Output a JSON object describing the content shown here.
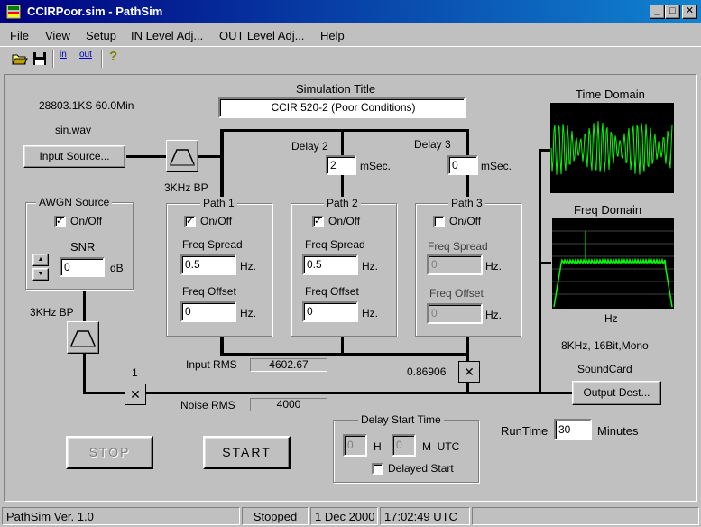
{
  "window": {
    "title": "CCIRPoor.sim - PathSim"
  },
  "menu": [
    "File",
    "View",
    "Setup",
    "IN Level Adj...",
    "OUT Level Adj...",
    "Help"
  ],
  "toolbar": {
    "in_label": "in",
    "out_label": "out",
    "help": "?"
  },
  "input": {
    "info": "28803.1KS  60.0Min",
    "file": "sin.wav",
    "source_button": "Input Source...",
    "bp_label": "3KHz BP"
  },
  "simulation": {
    "title_label": "Simulation Title",
    "title_value": "CCIR 520-2 (Poor Conditions)"
  },
  "delays": {
    "delay2_label": "Delay 2",
    "delay2_value": "2",
    "delay3_label": "Delay 3",
    "delay3_value": "0",
    "unit": "mSec."
  },
  "awgn": {
    "title": "AWGN Source",
    "onoff_label": "On/Off",
    "onoff_checked": true,
    "snr_label": "SNR",
    "snr_value": "0",
    "unit": "dB",
    "bp_label": "3KHz BP"
  },
  "paths": [
    {
      "title": "Path 1",
      "onoff_label": "On/Off",
      "checked": true,
      "spread_label": "Freq Spread",
      "spread_value": "0.5",
      "offset_label": "Freq Offset",
      "offset_value": "0",
      "unit": "Hz.",
      "disabled": false
    },
    {
      "title": "Path 2",
      "onoff_label": "On/Off",
      "checked": true,
      "spread_label": "Freq Spread",
      "spread_value": "0.5",
      "offset_label": "Freq Offset",
      "offset_value": "0",
      "unit": "Hz.",
      "disabled": false
    },
    {
      "title": "Path 3",
      "onoff_label": "On/Off",
      "checked": false,
      "spread_label": "Freq Spread",
      "spread_value": "0",
      "offset_label": "Freq Offset",
      "offset_value": "0",
      "unit": "Hz.",
      "disabled": true
    }
  ],
  "rms": {
    "input_label": "Input RMS",
    "input_value": "4602.67",
    "noise_label": "Noise RMS",
    "noise_value": "4000",
    "gain_noise": "1",
    "gain_signal": "0.86906"
  },
  "displays": {
    "time_label": "Time Domain",
    "freq_label": "Freq Domain",
    "freq_unit": "Hz",
    "format": "8KHz, 16Bit,Mono",
    "soundcard_label": "SoundCard",
    "output_button": "Output Dest..."
  },
  "controls": {
    "stop_label": "STOP",
    "start_label": "START"
  },
  "delay_start": {
    "title": "Delay Start Time",
    "hours_value": "0",
    "h_label": "H",
    "minutes_value": "0",
    "m_label": "M  UTC",
    "delayed_label": "Delayed Start",
    "delayed_checked": false
  },
  "runtime": {
    "label": "RunTime",
    "value": "30",
    "unit": "Minutes"
  },
  "status": {
    "version": "PathSim Ver. 1.0",
    "state": "Stopped",
    "date": "1 Dec 2000",
    "time": "17:02:49 UTC"
  },
  "colors": {
    "titlebar": "#000080",
    "scope_bg": "#000000",
    "trace": "#00ff00"
  }
}
